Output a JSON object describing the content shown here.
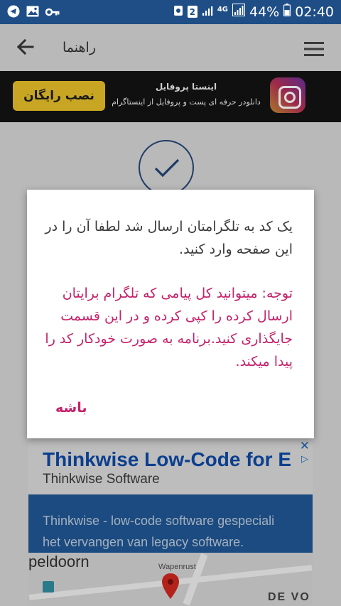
{
  "status_bar": {
    "battery": "44%",
    "time": "02:40",
    "sim_badge": "2",
    "network": "4G",
    "left_icons": [
      "telegram-icon",
      "image-icon",
      "key-icon"
    ],
    "right_icons": [
      "android-icon",
      "sim-icon",
      "signal-icon",
      "battery-icon"
    ]
  },
  "toolbar": {
    "title": "راهنما",
    "back_icon": "arrow-left-icon",
    "menu_icon": "hamburger-icon"
  },
  "banner": {
    "button": "نصب رایگان",
    "title": "اینستا پروفایل",
    "subtitle": "دانلودر حرفه ای پست و پروفایل از اینستاگرام",
    "logo": "instagram-logo"
  },
  "dialog": {
    "message": "یک کد به تلگرامتان ارسال شد لطفا آن را در این صفحه وارد کنید.",
    "note": "توجه: میتوانید کل پیامی که تلگرام برایتان ارسال کرده را کپی کرده و در این قسمت جایگذاری کنید.برنامه به صورت خودکار کد را پیدا میکند.",
    "ok_button": "باشه"
  },
  "ad": {
    "headline": "Thinkwise Low-Code for E",
    "advertiser": "Thinkwise Software",
    "description_line1": "Thinkwise - low-code software gespeciali",
    "description_line2": "het vervangen van legacy software.",
    "map_label_1": "peldoorn",
    "map_label_2": "Wapenrust",
    "map_label_3": "DE VO",
    "close": "✕",
    "info": "▷"
  },
  "colors": {
    "status_bar": "#1f4e86",
    "accent_pink": "#c6226a",
    "banner_button": "#c8a624",
    "ad_headline": "#0b3f8f"
  }
}
